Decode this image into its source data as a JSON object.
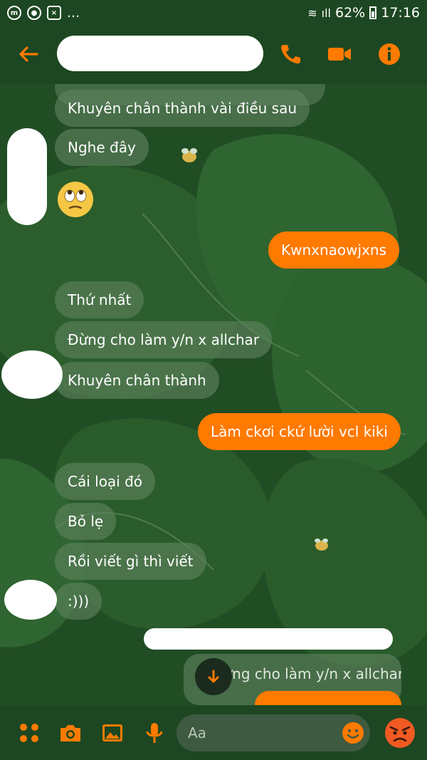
{
  "status_bar": {
    "dots": "...",
    "battery": "62%",
    "time": "17:16"
  },
  "header": {
    "back_icon": "back-arrow-icon",
    "call_icon": "phone-icon",
    "video_icon": "video-camera-icon",
    "info_icon": "info-icon"
  },
  "messages": [
    {
      "side": "in",
      "text": "Khuyên chân thành vài điều sau"
    },
    {
      "side": "in",
      "text": "Nghe đây"
    },
    {
      "side": "in",
      "text": "🙄"
    },
    {
      "side": "out",
      "text": "Kwnxnaowjxns"
    },
    {
      "side": "in",
      "text": "Thứ nhất"
    },
    {
      "side": "in",
      "text": "Đừng cho làm y/n x allchar"
    },
    {
      "side": "in",
      "text": "Khuyên chân thành"
    },
    {
      "side": "out",
      "text": "Làm ckơi ckứ lười vcl kiki"
    },
    {
      "side": "in",
      "text": "Cái loại đó"
    },
    {
      "side": "in",
      "text": "Bỏ lẹ"
    },
    {
      "side": "in",
      "text": "Rồi viết gì thì viết"
    },
    {
      "side": "in",
      "text": ":)))"
    },
    {
      "side": "in",
      "text": "Đừng cho làm y/n x allchar"
    }
  ],
  "composer": {
    "placeholder": "Aa",
    "icons": [
      "menu-dots-icon",
      "camera-icon",
      "image-icon",
      "microphone-icon",
      "emoji-icon",
      "angry-face-icon"
    ]
  },
  "colors": {
    "accent": "#ff7a00",
    "background": "#1f4a22",
    "incoming_bubble": "#5f825f"
  }
}
